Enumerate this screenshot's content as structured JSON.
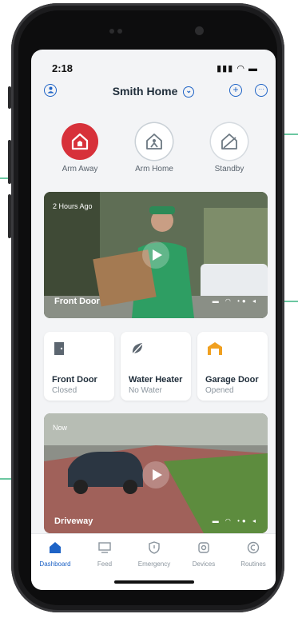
{
  "status": {
    "time": "2:18",
    "icons": "▮▮▮ ◠ ▬"
  },
  "header": {
    "title": "Smith Home",
    "chevron": "⌄",
    "add": "+",
    "more": "···"
  },
  "modes": [
    {
      "label": "Arm Away",
      "icon": "house-shield-icon"
    },
    {
      "label": "Arm Home",
      "icon": "house-person-icon"
    },
    {
      "label": "Standby",
      "icon": "house-off-icon"
    }
  ],
  "cameras": [
    {
      "time": "2 Hours Ago",
      "name": "Front Door"
    },
    {
      "time": "Now",
      "name": "Driveway"
    }
  ],
  "devices": [
    {
      "name": "Front Door",
      "status": "Closed",
      "icon": "door-icon"
    },
    {
      "name": "Water Heater",
      "status": "No Water",
      "icon": "leaf-off-icon"
    },
    {
      "name": "Garage Door",
      "status": "Opened",
      "icon": "garage-icon"
    }
  ],
  "tabs": [
    {
      "label": "Dashboard",
      "icon": "house-icon"
    },
    {
      "label": "Feed",
      "icon": "monitor-icon"
    },
    {
      "label": "Emergency",
      "icon": "shield-alert-icon"
    },
    {
      "label": "Devices",
      "icon": "device-icon"
    },
    {
      "label": "Routines",
      "icon": "routine-icon"
    }
  ],
  "colors": {
    "brand_red": "#d7313a",
    "accent_blue": "#1e63c6",
    "annotation_green": "#6bc7a1",
    "garage_orange": "#f0a020"
  }
}
